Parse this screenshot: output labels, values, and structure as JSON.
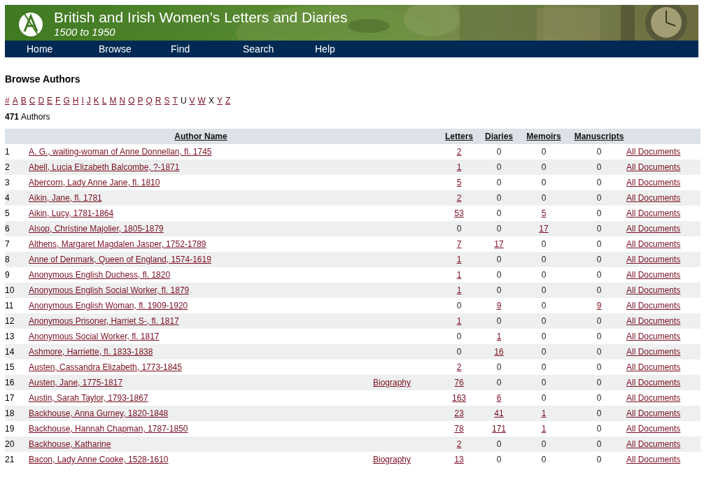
{
  "banner": {
    "title": "British and Irish Women’s Letters and Diaries",
    "subtitle": "1500 to 1950"
  },
  "nav": [
    "Home",
    "Browse",
    "Find",
    "Search",
    "Help"
  ],
  "heading": "Browse Authors",
  "alphabet": [
    {
      "label": "#",
      "link": true
    },
    {
      "label": "A",
      "link": true
    },
    {
      "label": "B",
      "link": true
    },
    {
      "label": "C",
      "link": true
    },
    {
      "label": "D",
      "link": true
    },
    {
      "label": "E",
      "link": true
    },
    {
      "label": "F",
      "link": true
    },
    {
      "label": "G",
      "link": true
    },
    {
      "label": "H",
      "link": true
    },
    {
      "label": "I",
      "link": true
    },
    {
      "label": "J",
      "link": true
    },
    {
      "label": "K",
      "link": true
    },
    {
      "label": "L",
      "link": true
    },
    {
      "label": "M",
      "link": true
    },
    {
      "label": "N",
      "link": true
    },
    {
      "label": "O",
      "link": true
    },
    {
      "label": "P",
      "link": true
    },
    {
      "label": "Q",
      "link": true
    },
    {
      "label": "R",
      "link": true
    },
    {
      "label": "S",
      "link": true
    },
    {
      "label": "T",
      "link": true
    },
    {
      "label": "U",
      "link": false
    },
    {
      "label": "V",
      "link": true
    },
    {
      "label": "W",
      "link": true
    },
    {
      "label": "X",
      "link": false
    },
    {
      "label": "Y",
      "link": true
    },
    {
      "label": "Z",
      "link": true
    }
  ],
  "count": {
    "number": "471",
    "label": "Authors"
  },
  "table": {
    "columns": [
      "Author Name",
      "Letters",
      "Diaries",
      "Memoirs",
      "Manuscripts"
    ],
    "rows": [
      {
        "n": "1",
        "name": "A. G., waiting-woman of Anne Donnellan, fl. 1745",
        "letters": "2",
        "diaries": "0",
        "memoirs": "0",
        "manuscripts": "0",
        "all": "All Documents"
      },
      {
        "n": "2",
        "name": "Abell, Lucia Elizabeth Balcombe, ?-1871",
        "letters": "1",
        "diaries": "0",
        "memoirs": "0",
        "manuscripts": "0",
        "all": "All Documents"
      },
      {
        "n": "3",
        "name": "Abercorn, Lady Anne Jane, fl. 1810",
        "letters": "5",
        "diaries": "0",
        "memoirs": "0",
        "manuscripts": "0",
        "all": "All Documents"
      },
      {
        "n": "4",
        "name": "Aikin, Jane, fl. 1781",
        "letters": "2",
        "diaries": "0",
        "memoirs": "0",
        "manuscripts": "0",
        "all": "All Documents"
      },
      {
        "n": "5",
        "name": "Aikin, Lucy, 1781-1864",
        "letters": "53",
        "diaries": "0",
        "memoirs": "5",
        "manuscripts": "0",
        "all": "All Documents"
      },
      {
        "n": "6",
        "name": "Alsop, Christine Majolier, 1805-1879",
        "letters": "0",
        "diaries": "0",
        "memoirs": "17",
        "manuscripts": "0",
        "all": "All Documents"
      },
      {
        "n": "7",
        "name": "Althens, Margaret Magdalen Jasper, 1752-1789",
        "letters": "7",
        "diaries": "17",
        "memoirs": "0",
        "manuscripts": "0",
        "all": "All Documents"
      },
      {
        "n": "8",
        "name": "Anne of Denmark, Queen of England, 1574-1619",
        "letters": "1",
        "diaries": "0",
        "memoirs": "0",
        "manuscripts": "0",
        "all": "All Documents"
      },
      {
        "n": "9",
        "name": "Anonymous English Duchess, fl. 1820",
        "letters": "1",
        "diaries": "0",
        "memoirs": "0",
        "manuscripts": "0",
        "all": "All Documents"
      },
      {
        "n": "10",
        "name": "Anonymous English Social Worker, fl. 1879",
        "letters": "1",
        "diaries": "0",
        "memoirs": "0",
        "manuscripts": "0",
        "all": "All Documents"
      },
      {
        "n": "11",
        "name": "Anonymous English Woman, fl. 1909-1920",
        "letters": "0",
        "diaries": "9",
        "memoirs": "0",
        "manuscripts": "9",
        "all": "All Documents"
      },
      {
        "n": "12",
        "name": "Anonymous Prisoner, Harriet S-, fl. 1817",
        "letters": "1",
        "diaries": "0",
        "memoirs": "0",
        "manuscripts": "0",
        "all": "All Documents"
      },
      {
        "n": "13",
        "name": "Anonymous Social Worker, fl. 1817",
        "letters": "0",
        "diaries": "1",
        "memoirs": "0",
        "manuscripts": "0",
        "all": "All Documents"
      },
      {
        "n": "14",
        "name": "Ashmore, Harriette, fl. 1833-1838",
        "letters": "0",
        "diaries": "16",
        "memoirs": "0",
        "manuscripts": "0",
        "all": "All Documents"
      },
      {
        "n": "15",
        "name": "Austen, Cassandra Elizabeth, 1773-1845",
        "letters": "2",
        "diaries": "0",
        "memoirs": "0",
        "manuscripts": "0",
        "all": "All Documents"
      },
      {
        "n": "16",
        "name": "Austen, Jane, 1775-1817",
        "biography": "Biography",
        "letters": "76",
        "diaries": "0",
        "memoirs": "0",
        "manuscripts": "0",
        "all": "All Documents"
      },
      {
        "n": "17",
        "name": "Austin, Sarah Taylor, 1793-1867",
        "letters": "163",
        "diaries": "6",
        "memoirs": "0",
        "manuscripts": "0",
        "all": "All Documents"
      },
      {
        "n": "18",
        "name": "Backhouse, Anna Gurney, 1820-1848",
        "letters": "23",
        "diaries": "41",
        "memoirs": "1",
        "manuscripts": "0",
        "all": "All Documents"
      },
      {
        "n": "19",
        "name": "Backhouse, Hannah Chapman, 1787-1850",
        "letters": "78",
        "diaries": "171",
        "memoirs": "1",
        "manuscripts": "0",
        "all": "All Documents"
      },
      {
        "n": "20",
        "name": "Backhouse, Katharine",
        "letters": "2",
        "diaries": "0",
        "memoirs": "0",
        "manuscripts": "0",
        "all": "All Documents"
      },
      {
        "n": "21",
        "name": "Bacon, Lady Anne Cooke, 1528-1610",
        "biography": "Biography",
        "letters": "13",
        "diaries": "0",
        "memoirs": "0",
        "manuscripts": "0",
        "all": "All Documents"
      }
    ]
  }
}
